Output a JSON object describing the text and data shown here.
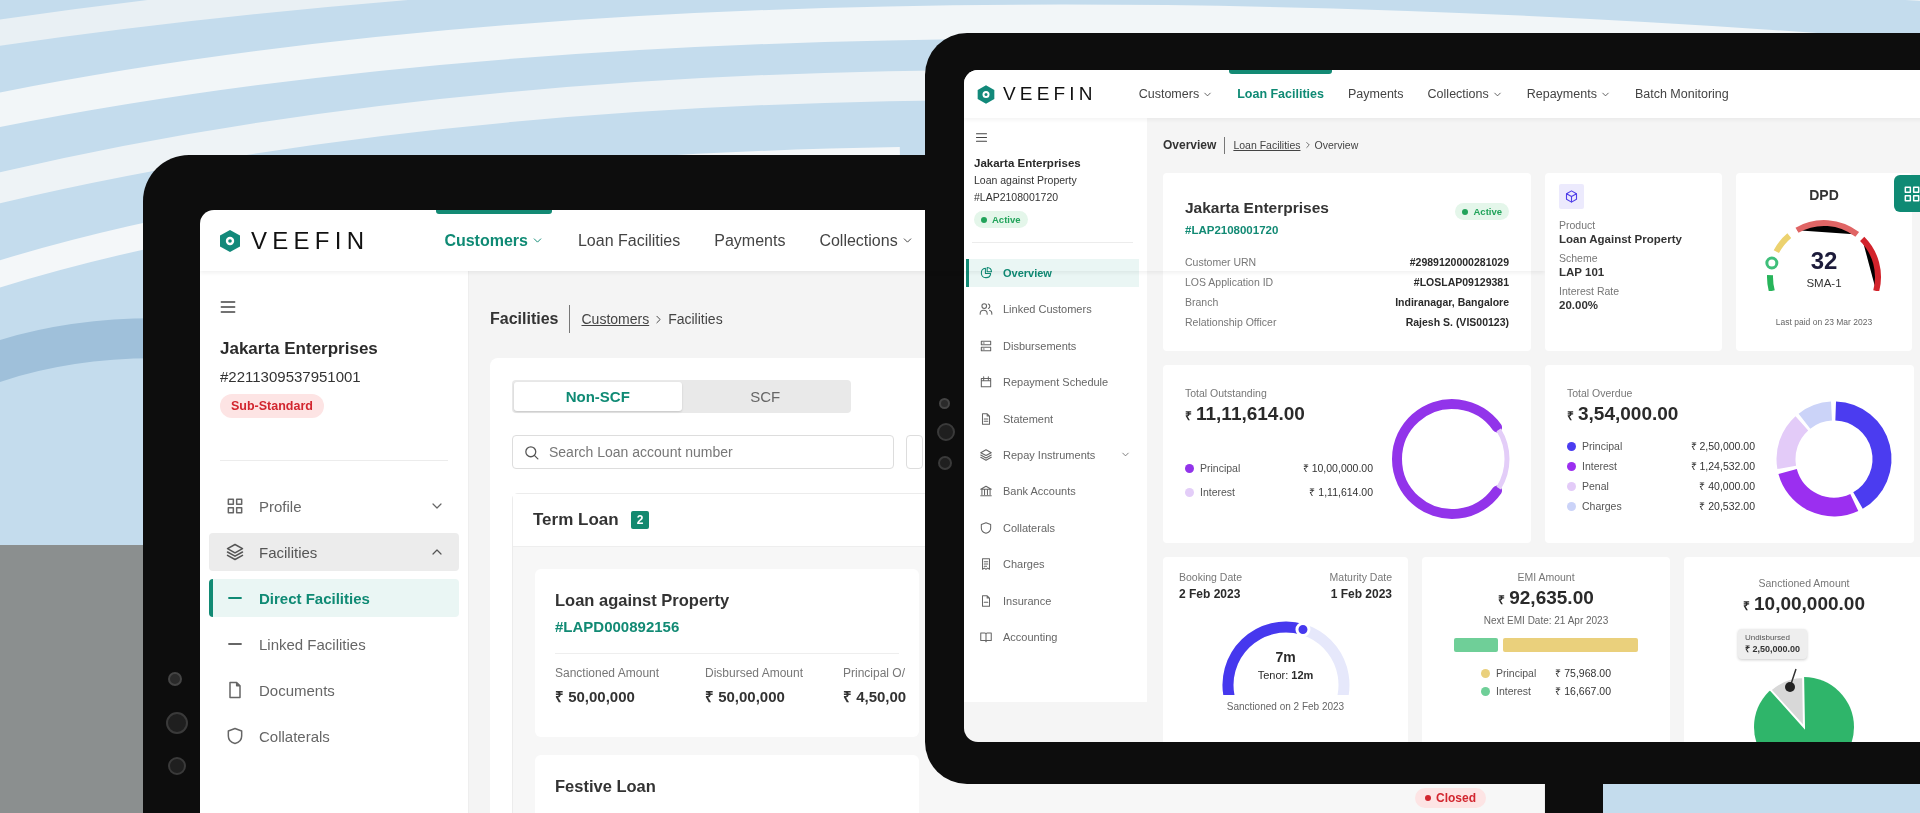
{
  "left_tablet": {
    "nav": {
      "logo": "VEEFIN",
      "items": [
        {
          "label": "Customers",
          "dropdown": true,
          "selected": true
        },
        {
          "label": "Loan Facilities",
          "dropdown": false,
          "selected": false
        },
        {
          "label": "Payments",
          "dropdown": false,
          "selected": false
        },
        {
          "label": "Collections",
          "dropdown": true,
          "selected": false
        }
      ]
    },
    "sidebar": {
      "name": "Jakarta Enterprises",
      "id": "#2211309537951001",
      "status": {
        "label": "Sub-Standard",
        "kind": "danger"
      },
      "items": [
        {
          "label": "Profile",
          "expanded": false,
          "selected": false
        },
        {
          "label": "Facilities",
          "expanded": true,
          "selected": false,
          "children": [
            {
              "label": "Direct Facilities",
              "selected": true
            },
            {
              "label": "Linked Facilities",
              "selected": false
            }
          ]
        },
        {
          "label": "Documents",
          "selected": false
        },
        {
          "label": "Collaterals",
          "selected": false
        }
      ]
    },
    "main": {
      "title": "Facilities",
      "breadcrumb": [
        {
          "label": "Customers",
          "link": true
        },
        {
          "label": "Facilities",
          "link": false
        }
      ],
      "segments": [
        {
          "label": "Non-SCF",
          "selected": true
        },
        {
          "label": "SCF",
          "selected": false
        }
      ],
      "search": {
        "placeholder": "Search Loan account number"
      },
      "section": {
        "title": "Term Loan",
        "count": "2"
      },
      "loans": [
        {
          "name": "Loan against Property",
          "id": "#LAPD000892156",
          "fields": [
            {
              "label": "Sanctioned Amount",
              "value": "₹ 50,00,000"
            },
            {
              "label": "Disbursed Amount",
              "value": "₹ 50,00,000"
            },
            {
              "label": "Principal O/",
              "value": "₹ 4,50,00"
            }
          ]
        },
        {
          "name": "Festive Loan",
          "status": {
            "label": "Closed",
            "kind": "danger"
          }
        }
      ]
    }
  },
  "right_tablet": {
    "nav": {
      "logo": "VEEFIN",
      "items": [
        {
          "label": "Customers",
          "dropdown": true,
          "selected": false
        },
        {
          "label": "Loan Facilities",
          "dropdown": false,
          "selected": true
        },
        {
          "label": "Payments",
          "dropdown": false,
          "selected": false
        },
        {
          "label": "Collections",
          "dropdown": true,
          "selected": false
        },
        {
          "label": "Repayments",
          "dropdown": true,
          "selected": false
        },
        {
          "label": "Batch Monitoring",
          "dropdown": false,
          "selected": false
        }
      ]
    },
    "sidebar": {
      "name": "Jakarta Enterprises",
      "product": "Loan against Property",
      "id": "#LAP2108001720",
      "status": {
        "label": "Active",
        "kind": "success"
      },
      "items": [
        {
          "label": "Overview",
          "selected": true
        },
        {
          "label": "Linked Customers",
          "selected": false
        },
        {
          "label": "Disbursements",
          "selected": false
        },
        {
          "label": "Repayment Schedule",
          "selected": false
        },
        {
          "label": "Statement",
          "selected": false
        },
        {
          "label": "Repay Instruments",
          "expanded": false,
          "selected": false
        },
        {
          "label": "Bank Accounts",
          "selected": false
        },
        {
          "label": "Collaterals",
          "selected": false
        },
        {
          "label": "Charges",
          "selected": false
        },
        {
          "label": "Insurance",
          "selected": false
        },
        {
          "label": "Accounting",
          "selected": false
        }
      ]
    },
    "main": {
      "title": "Overview",
      "breadcrumb": [
        {
          "label": "Loan Facilities",
          "link": true
        },
        {
          "label": "Overview",
          "link": false
        }
      ],
      "summary": {
        "name": "Jakarta Enterprises",
        "id": "#LAP2108001720",
        "status": {
          "label": "Active",
          "kind": "success"
        },
        "details": [
          {
            "label": "Customer URN",
            "value": "#2989120000281029"
          },
          {
            "label": "LOS Application ID",
            "value": "#LOSLAP09129381"
          },
          {
            "label": "Branch",
            "value": "Indiranagar, Bangalore"
          },
          {
            "label": "Relationship Officer",
            "value": "Rajesh S. (VIS00123)"
          }
        ]
      },
      "product": {
        "fields": [
          {
            "label": "Product",
            "value": "Loan Against Property"
          },
          {
            "label": "Scheme",
            "value": "LAP 101"
          },
          {
            "label": "Interest Rate",
            "value": "20.00%"
          }
        ]
      },
      "dpd": {
        "title": "DPD",
        "value": "32",
        "class": "SMA-1",
        "note": "Last paid on 23 Mar 2023"
      },
      "outstanding": {
        "label": "Total Outstanding",
        "currency": "₹",
        "amount": "11,11,614.00",
        "legend": [
          {
            "label": "Principal",
            "value": "₹ 10,00,000.00",
            "color": "#9234ea"
          },
          {
            "label": "Interest",
            "value": "₹ 1,11,614.00",
            "color": "#e3cdf8"
          }
        ]
      },
      "overdue": {
        "label": "Total Overdue",
        "currency": "₹",
        "amount": "3,54,000.00",
        "legend": [
          {
            "label": "Principal",
            "value": "₹ 2,50,000.00",
            "color": "#4b3cf0"
          },
          {
            "label": "Interest",
            "value": "₹ 1,24,532.00",
            "color": "#9b2ff0"
          },
          {
            "label": "Penal",
            "value": "₹ 40,000.00",
            "color": "#e3cbf8"
          },
          {
            "label": "Charges",
            "value": "₹ 20,532.00",
            "color": "#cbd3f8"
          }
        ]
      },
      "tenor": {
        "dates": [
          {
            "label": "Booking Date",
            "value": "2 Feb 2023"
          },
          {
            "label": "Maturity Date",
            "value": "1 Feb 2023"
          }
        ],
        "elapsed": "7m",
        "tenor": "Tenor: **12m**",
        "note": "Sanctioned on 2 Feb 2023"
      },
      "emi": {
        "label": "EMI Amount",
        "currency": "₹",
        "amount": "92,635.00",
        "next": "Next EMI Date: 21 Apr 2023",
        "legend": [
          {
            "label": "Principal",
            "value": "₹ 75,968.00",
            "color": "#ead07c"
          },
          {
            "label": "Interest",
            "value": "₹ 16,667.00",
            "color": "#6fcf98"
          }
        ]
      },
      "sanctioned": {
        "label": "Sanctioned Amount",
        "currency": "₹",
        "amount": "10,00,000.00",
        "tooltip": {
          "label": "Undisbursed",
          "value": "₹ 2,50,000.00"
        }
      }
    }
  }
}
